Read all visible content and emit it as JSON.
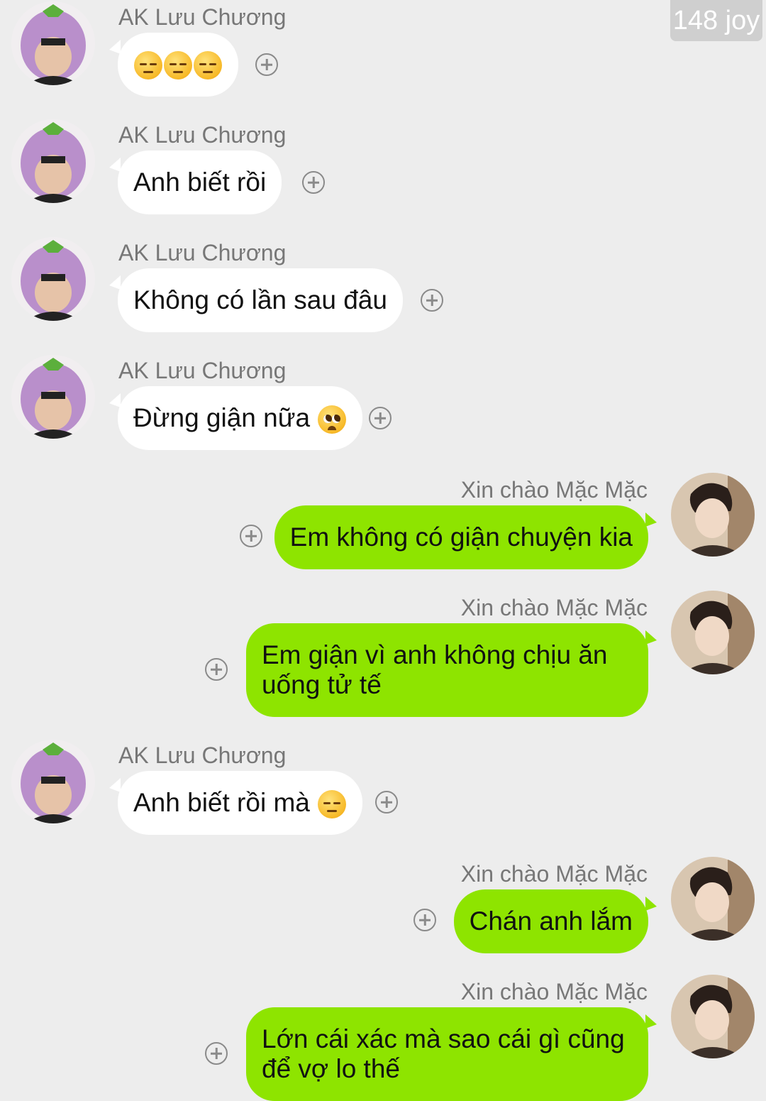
{
  "watermark": "148 joy",
  "colors": {
    "background": "#ededed",
    "incoming_bubble": "#ffffff",
    "outgoing_bubble": "#8ee400",
    "sender_name": "#777777"
  },
  "messages": [
    {
      "direction": "incoming",
      "sender": "AK Lưu Chương",
      "text": "",
      "emojis": [
        "pensive-face-emoji",
        "pensive-face-emoji",
        "pensive-face-emoji"
      ]
    },
    {
      "direction": "incoming",
      "sender": "AK Lưu Chương",
      "text": "Anh biết rồi"
    },
    {
      "direction": "incoming",
      "sender": "AK Lưu Chương",
      "text": "Không có lần sau đâu"
    },
    {
      "direction": "incoming",
      "sender": "AK Lưu Chương",
      "text": "Đừng giận nữa",
      "emojis": [
        "pleading-face-emoji"
      ]
    },
    {
      "direction": "outgoing",
      "sender": "Xin chào Mặc Mặc",
      "text": "Em không có giận chuyện kia"
    },
    {
      "direction": "outgoing",
      "sender": "Xin chào Mặc Mặc",
      "text_lines": [
        "Em giận vì anh không chịu ăn",
        "uống tử tế"
      ]
    },
    {
      "direction": "incoming",
      "sender": "AK Lưu Chương",
      "text": "Anh biết rồi mà",
      "emojis": [
        "pensive-face-emoji"
      ]
    },
    {
      "direction": "outgoing",
      "sender": "Xin chào Mặc Mặc",
      "text": "Chán anh lắm"
    },
    {
      "direction": "outgoing",
      "sender": "Xin chào Mặc Mặc",
      "text_lines": [
        "Lớn cái xác mà sao cái gì cũng",
        "để vợ lo thế"
      ]
    }
  ],
  "icons": {
    "add": "plus-circle-icon",
    "incoming_avatar": "eggplant-hat-avatar",
    "outgoing_avatar": "profile-photo-avatar"
  }
}
